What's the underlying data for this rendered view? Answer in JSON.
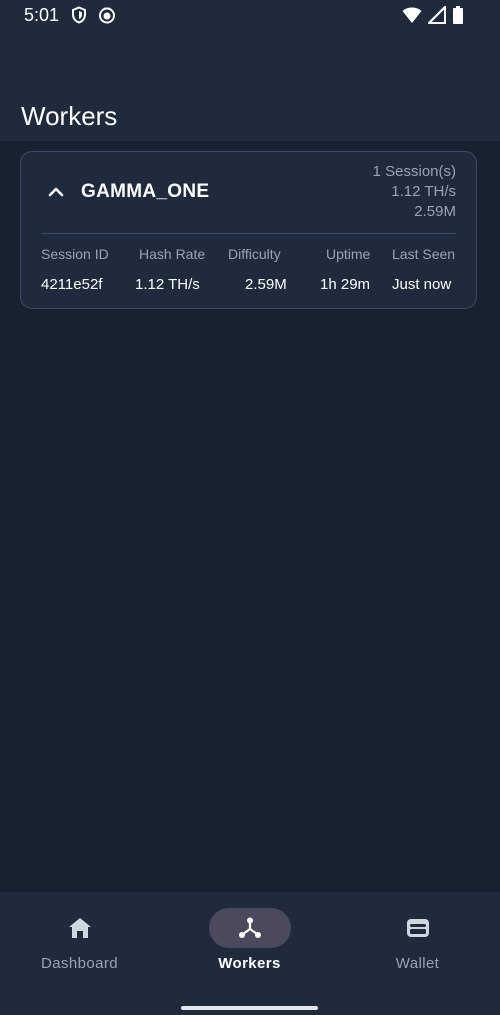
{
  "status_bar": {
    "time": "5:01",
    "icons": [
      "shield-icon",
      "notification-bubble-icon",
      "wifi-icon",
      "signal-icon",
      "battery-icon"
    ]
  },
  "app_bar": {
    "title": "Workers"
  },
  "worker_card": {
    "name": "GAMMA_ONE",
    "expanded": true,
    "summary": {
      "sessions": "1 Session(s)",
      "hash_rate": "1.12 TH/s",
      "difficulty": "2.59M"
    },
    "table": {
      "headers": [
        "Session ID",
        "Hash Rate",
        "Difficulty",
        "Uptime",
        "Last Seen"
      ],
      "rows": [
        [
          "4211e52f",
          "1.12 TH/s",
          "2.59M",
          "1h 29m",
          "Just now"
        ]
      ]
    }
  },
  "bottom_nav": {
    "items": [
      {
        "label": "Dashboard",
        "icon": "home-icon",
        "active": false
      },
      {
        "label": "Workers",
        "icon": "hub-icon",
        "active": true
      },
      {
        "label": "Wallet",
        "icon": "wallet-icon",
        "active": false
      }
    ]
  },
  "colors": {
    "background": "#18212f",
    "surface": "#1f2a3d",
    "border": "#3a4a66",
    "text_primary": "#ffffff",
    "text_secondary": "#9aa3b2",
    "active_pill": "#4b4a5c"
  }
}
